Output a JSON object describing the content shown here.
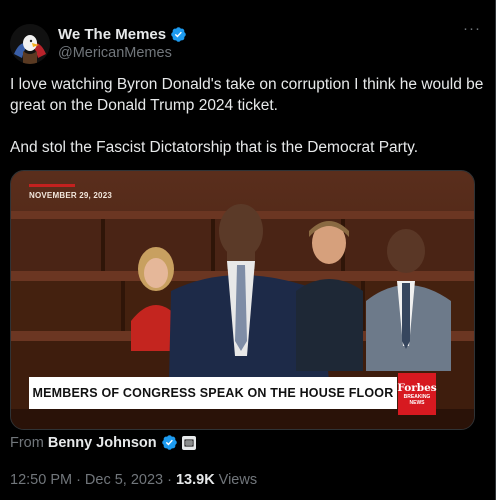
{
  "author": {
    "display_name": "We The Memes",
    "handle": "@MericanMemes",
    "avatar_icon": "eagle-avatar",
    "verified": true
  },
  "tweet": {
    "paragraph_1": "I love watching Byron Donald's take on corruption I think he would be great on the Donald Trump 2024 ticket.",
    "paragraph_2": "And stol the Fascist Dictatorship that is the Democrat Party."
  },
  "media": {
    "date_tag": "NOVEMBER 29, 2023",
    "lower_third": "MEMBERS OF CONGRESS SPEAK ON THE HOUSE FLOOR",
    "network_logo": "Forbes",
    "network_sub": "BREAKING NEWS"
  },
  "attribution": {
    "from_label": "From",
    "from_name": "Benny Johnson"
  },
  "meta": {
    "time": "12:50 PM",
    "separator_1": "·",
    "date": "Dec 5, 2023",
    "separator_2": "·",
    "views_count": "13.9K",
    "views_label": "Views"
  },
  "colors": {
    "background": "#000000",
    "text": "#e7e9ea",
    "muted": "#71767b",
    "verified_blue": "#1d9bf0",
    "forbes_red": "#d71920"
  }
}
